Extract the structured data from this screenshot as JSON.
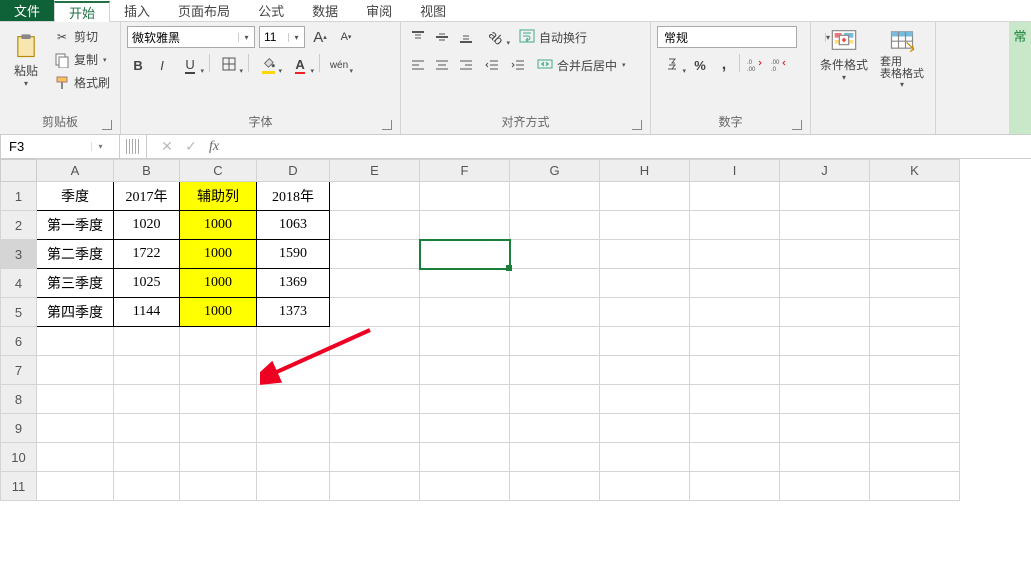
{
  "menu": {
    "file": "文件",
    "tabs": [
      "开始",
      "插入",
      "页面布局",
      "公式",
      "数据",
      "审阅",
      "视图"
    ],
    "active_index": 0
  },
  "ribbon": {
    "clipboard": {
      "paste": "粘贴",
      "cut": "剪切",
      "copy": "复制",
      "format_painter": "格式刷",
      "group_label": "剪贴板"
    },
    "font": {
      "name": "微软雅黑",
      "size": "11",
      "increase_glyph": "A",
      "decrease_glyph": "A",
      "bold": "B",
      "italic": "I",
      "underline": "U",
      "pinyin": "wén",
      "group_label": "字体"
    },
    "alignment": {
      "wrap_text": "自动换行",
      "merge_center": "合并后居中",
      "group_label": "对齐方式"
    },
    "number": {
      "format": "常规",
      "percent": "%",
      "comma": ",",
      "group_label": "数字"
    },
    "styles": {
      "cond_fmt": "条件格式",
      "table_fmt": "套用\n表格格式"
    },
    "accent_side": "常"
  },
  "namebox": "F3",
  "fx_value": "",
  "icons": {
    "fx": "fx",
    "cancel": "✕",
    "confirm": "✓"
  },
  "columns": [
    "A",
    "B",
    "C",
    "D",
    "E",
    "F",
    "G",
    "H",
    "I",
    "J",
    "K"
  ],
  "rows": [
    1,
    2,
    3,
    4,
    5,
    6,
    7,
    8,
    9,
    10,
    11
  ],
  "active_cell": {
    "row": 3,
    "col": "F"
  },
  "data": {
    "A1": "季度",
    "B1": "2017年",
    "C1": "辅助列",
    "D1": "2018年",
    "A2": "第一季度",
    "B2": "1020",
    "C2": "1000",
    "D2": "1063",
    "A3": "第二季度",
    "B3": "1722",
    "C3": "1000",
    "D3": "1590",
    "A4": "第三季度",
    "B4": "1025",
    "C4": "1000",
    "D4": "1369",
    "A5": "第四季度",
    "B5": "1144",
    "C5": "1000",
    "D5": "1373"
  },
  "highlight_cells": [
    "C1",
    "C2",
    "C3",
    "C4",
    "C5"
  ],
  "databox_range": {
    "cols": [
      "A",
      "B",
      "C",
      "D"
    ],
    "rows": [
      1,
      2,
      3,
      4,
      5
    ]
  }
}
